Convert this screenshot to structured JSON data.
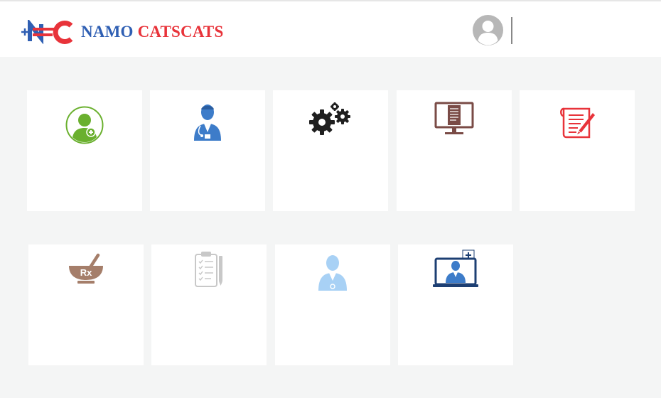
{
  "header": {
    "brand_part1": "NAMO",
    "brand_part2": "CATSCATS",
    "colors": {
      "blue": "#2f5fb3",
      "red": "#e8333a"
    }
  },
  "profile": {
    "icon": "user-avatar-icon"
  },
  "tiles_row1": [
    {
      "icon": "add-patient-icon",
      "label": ""
    },
    {
      "icon": "doctor-icon",
      "label": ""
    },
    {
      "icon": "settings-gears-icon",
      "label": ""
    },
    {
      "icon": "monitor-document-icon",
      "label": ""
    },
    {
      "icon": "prescription-note-icon",
      "label": ""
    }
  ],
  "tiles_row2": [
    {
      "icon": "pharmacy-mortar-rx-icon",
      "label": ""
    },
    {
      "icon": "clipboard-checklist-icon",
      "label": ""
    },
    {
      "icon": "doctor-silhouette-icon",
      "label": ""
    },
    {
      "icon": "telemedicine-laptop-doctor-icon",
      "label": ""
    }
  ]
}
